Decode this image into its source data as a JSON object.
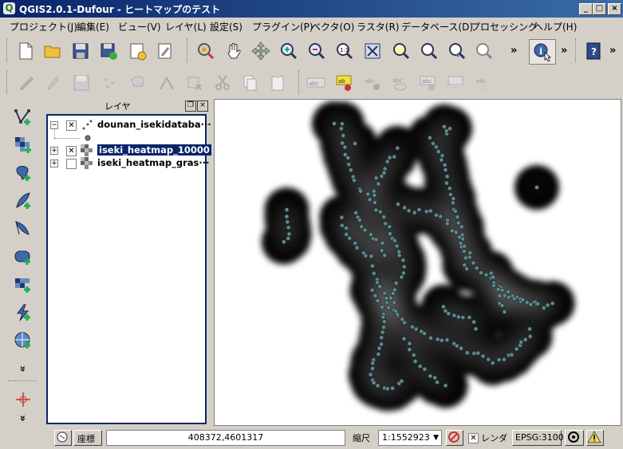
{
  "window": {
    "title": "QGIS2.0.1-Dufour - ヒートマップのテスト",
    "min_label": "_",
    "max_label": "□",
    "close_label": "×"
  },
  "menu": {
    "items": [
      "プロジェクト(J)",
      "編集(E)",
      "ビュー(V)",
      "レイヤ(L)",
      "設定(S)",
      "プラグイン(P)",
      "ベクタ(O)",
      "ラスタ(R)",
      "データベース(D)",
      "プロセッシング",
      "ヘルプ(H)"
    ]
  },
  "toolbar": {
    "more1": "»",
    "more2": "»",
    "more3": "»",
    "icons_row1": [
      "new-project-icon",
      "open-project-icon",
      "save-project-icon",
      "save-as-icon",
      "new-print-composer-icon",
      "composer-manager-icon",
      "pan-to-selection-icon",
      "pan-icon",
      "zoom-to-selection-icon",
      "zoom-in-icon",
      "zoom-out-icon",
      "zoom-actual-size-icon",
      "zoom-full-icon",
      "zoom-to-layer-icon",
      "zoom-last-icon",
      "zoom-next-icon",
      "identify-icon",
      "help-icon"
    ],
    "icons_row2": [
      "edit-pencil-icon",
      "toggle-editing-icon",
      "save-edits-icon",
      "add-feature-icon",
      "move-feature-icon",
      "node-tool-icon",
      "delete-selected-icon",
      "cut-icon",
      "copy-icon",
      "paste-icon",
      "label-icon",
      "pin-label-icon",
      "show-hide-labels-icon",
      "move-label-icon",
      "rotate-label-icon",
      "change-label-icon"
    ]
  },
  "left_toolbar": {
    "icons": [
      "add-vector-layer-icon",
      "add-raster-layer-icon",
      "add-postgis-layer-icon",
      "add-spatialite-layer-icon",
      "add-mssql-layer-icon",
      "add-oracle-layer-icon",
      "add-wms-layer-icon",
      "add-wcs-layer-icon",
      "add-wfs-layer-icon",
      "new-shapefile-icon"
    ],
    "more": "»"
  },
  "layers_panel": {
    "title": "レイヤ",
    "float_label": "❐",
    "close_label": "×",
    "layers": [
      {
        "name": "dounan_isekidataba···",
        "checked": true,
        "selected": false,
        "expanded": true
      },
      {
        "name": "iseki_heatmap_10000",
        "checked": true,
        "selected": true,
        "expanded": false
      },
      {
        "name": "iseki_heatmap_gras···",
        "checked": false,
        "selected": false,
        "expanded": false
      }
    ]
  },
  "map": {
    "description_points": 420
  },
  "statusbar": {
    "coord_label": "座標",
    "coord_value": "408372,4601317",
    "scale_label": "縮尺",
    "scale_value": "1:1552923",
    "render_label": "レンダ",
    "render_checked": true,
    "crs_label": "EPSG:3100"
  }
}
